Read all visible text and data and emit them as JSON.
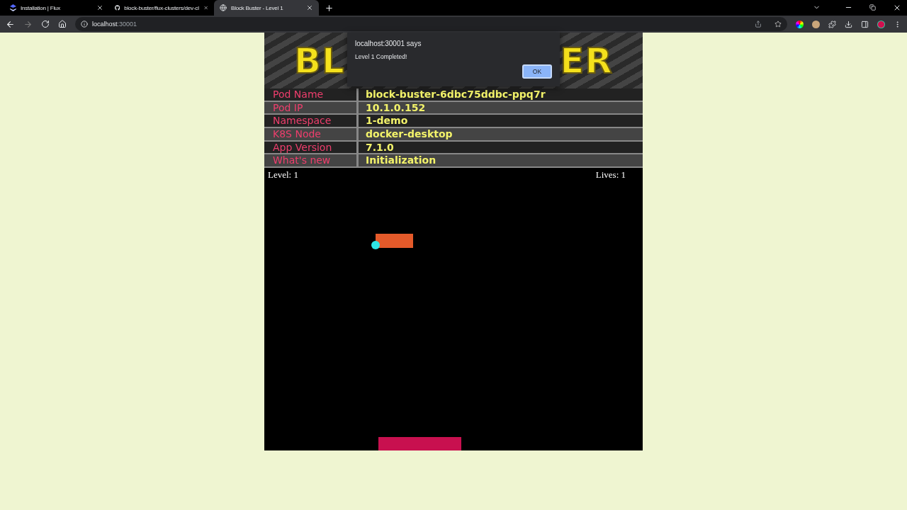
{
  "browser": {
    "tabs": [
      {
        "title": "Installation | Flux",
        "kind": "flux",
        "selected": false
      },
      {
        "title": "block-buster/flux-clusters/dev-cl",
        "kind": "github",
        "selected": false
      },
      {
        "title": "Block Buster - Level 1",
        "kind": "globe",
        "selected": true
      }
    ],
    "address": {
      "host": "localhost",
      "port": ":30001"
    }
  },
  "banner": {
    "left": "BL",
    "right": "ER"
  },
  "dialog": {
    "title": "localhost:30001 says",
    "message": "Level 1 Completed!",
    "button": "OK"
  },
  "info_rows": [
    {
      "label": "Pod Name",
      "value": "block-buster-6dbc75ddbc-ppq7r"
    },
    {
      "label": "Pod IP",
      "value": "10.1.0.152"
    },
    {
      "label": "Namespace",
      "value": "1-demo"
    },
    {
      "label": "K8S Node",
      "value": "docker-desktop"
    },
    {
      "label": "App Version",
      "value": "7.1.0"
    },
    {
      "label": "What's new",
      "value": "Initialization"
    }
  ],
  "game": {
    "level": "Level: 1",
    "lives": "Lives: 1"
  }
}
